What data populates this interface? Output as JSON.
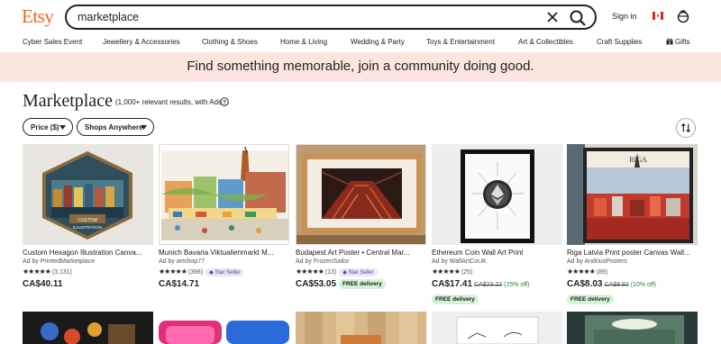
{
  "header": {
    "logo": "Etsy",
    "search_value": "marketplace",
    "signin": "Sign in"
  },
  "nav": {
    "items": [
      "Cyber Sales Event",
      "Jewellery & Accessories",
      "Clothing & Shoes",
      "Home & Living",
      "Wedding & Party",
      "Toys & Entertainment",
      "Art & Collectibles",
      "Craft Supplies",
      "Gifts"
    ]
  },
  "banner": {
    "text": "Find something memorable, join a community doing good."
  },
  "page": {
    "title": "Marketplace",
    "results": "(1,000+ relevant results, with Ads"
  },
  "filters": {
    "price": "Price ($)",
    "shops": "Shops Anywhere"
  },
  "listings": [
    {
      "title": "Custom Hexagon Illustration Canva...",
      "seller": "Ad by PrintedMarketplace",
      "stars": "★★★★★",
      "reviews": "(3,131)",
      "price": "CA$40.11"
    },
    {
      "title": "Munich Bavaria Viktualienmarkt M...",
      "seller": "Ad by artshop77",
      "stars": "★★★★★",
      "reviews": "(398)",
      "star_seller": "Star Seller",
      "price": "CA$14.71"
    },
    {
      "title": "Budapest Art Poster • Central Mar...",
      "seller": "Ad by FrozenSailor",
      "stars": "★★★★★",
      "reviews": "(13)",
      "star_seller": "Star Seller",
      "price": "CA$53.05",
      "free_delivery": "FREE delivery"
    },
    {
      "title": "Ethereum Coin Wall Art Print",
      "seller": "Ad by WallArtCoUK",
      "stars": "★★★★★",
      "reviews": "(25)",
      "price": "CA$17.41",
      "old_price": "CA$23.22",
      "discount": "(25% off)",
      "free_delivery": "FREE delivery"
    },
    {
      "title": "Riga Latvia Print poster Canvas Wall...",
      "seller": "Ad by AndriusPosters",
      "stars": "★★★★★",
      "reviews": "(89)",
      "price": "CA$8.03",
      "old_price": "CA$8.92",
      "discount": "(10% off)",
      "free_delivery": "FREE delivery"
    }
  ],
  "colors": {
    "brand": "#f1641e",
    "banner": "#fbe6df",
    "star_seller_bg": "#eae6f5",
    "free_delivery_bg": "#d4f2d8"
  },
  "icons": [
    "close-icon",
    "search-icon",
    "canada-flag-icon",
    "cart-icon",
    "gift-icon",
    "info-icon",
    "chevron-down-icon",
    "sort-icon"
  ]
}
